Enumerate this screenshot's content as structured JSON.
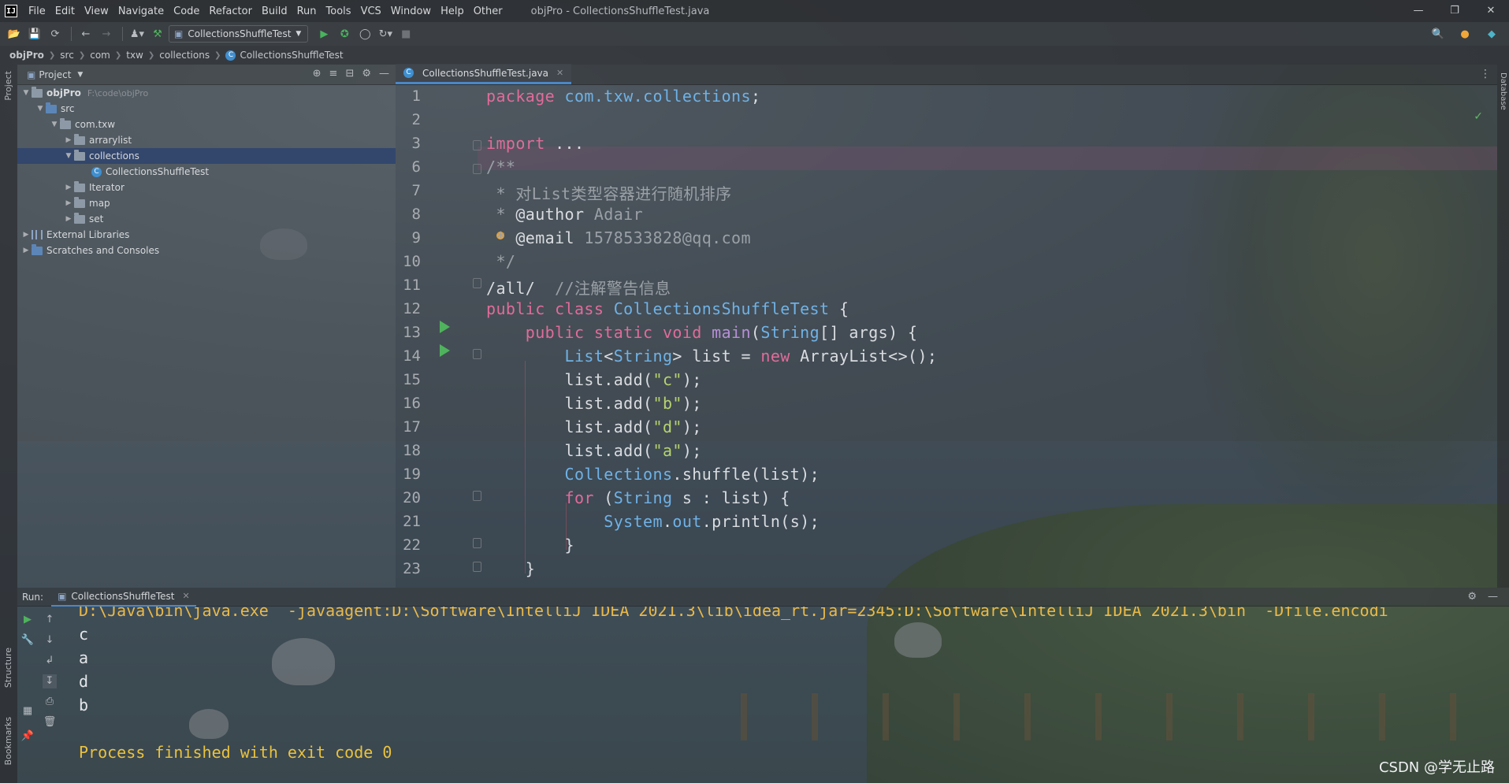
{
  "window": {
    "title": "objPro - CollectionsShuffleTest.java",
    "logo": "IJ",
    "controls": [
      "—",
      "❐",
      "✕"
    ]
  },
  "menu": [
    "File",
    "Edit",
    "View",
    "Navigate",
    "Code",
    "Refactor",
    "Build",
    "Run",
    "Tools",
    "VCS",
    "Window",
    "Help",
    "Other"
  ],
  "toolbar": {
    "run_config": "CollectionsShuffleTest"
  },
  "breadcrumb": [
    "objPro",
    "src",
    "com",
    "txw",
    "collections",
    "CollectionsShuffleTest"
  ],
  "left_strip": {
    "project": "Project",
    "structure": "Structure",
    "bookmarks": "Bookmarks"
  },
  "right_strip": {
    "database": "Database"
  },
  "project_panel": {
    "title": "Project",
    "root": {
      "name": "objPro",
      "path": "F:\\code\\objPro"
    },
    "src": "src",
    "package": "com.txw",
    "folders": [
      "arrarylist",
      "collections",
      "Iterator",
      "map",
      "set"
    ],
    "class_file": "CollectionsShuffleTest",
    "external_libraries": "External Libraries",
    "scratches": "Scratches and Consoles"
  },
  "editor": {
    "tab": "CollectionsShuffleTest.java",
    "line_numbers": [
      "1",
      "2",
      "3",
      "6",
      "7",
      "8",
      "9",
      "10",
      "11",
      "12",
      "13",
      "14",
      "15",
      "16",
      "17",
      "18",
      "19",
      "20",
      "21",
      "22",
      "23"
    ],
    "code": {
      "l1_kw": "package",
      "l1_pkg": "com.txw.collections",
      "l1_end": ";",
      "l3_kw": "import",
      "l3_rest": " ...",
      "l6": "/**",
      "l7": " * 对List类型容器进行随机排序",
      "l8_a": " * ",
      "l8_tag": "@author",
      "l8_val": " Adair",
      "l9_a": " * ",
      "l9_tag": "@email",
      "l9_val": " 1578533828@qq.com",
      "l10": " */",
      "l11_a": "/all/",
      "l11_cm": "  //注解警告信息",
      "l12_kw": "public class ",
      "l12_cls": "CollectionsShuffleTest",
      "l12_end": " {",
      "l13_kw": "    public static void ",
      "l13_fn": "main",
      "l13_p1": "(",
      "l13_ty": "String",
      "l13_p2": "[] args) {",
      "l14_ty1": "        List",
      "l14_p1": "<",
      "l14_ty2": "String",
      "l14_p2": "> list = ",
      "l14_kw": "new",
      "l14_p3": " ArrayList<>();",
      "l15_a": "        list.add(",
      "l15_s": "\"c\"",
      "l15_b": ");",
      "l16_a": "        list.add(",
      "l16_s": "\"b\"",
      "l16_b": ");",
      "l17_a": "        list.add(",
      "l17_s": "\"d\"",
      "l17_b": ");",
      "l18_a": "        list.add(",
      "l18_s": "\"a\"",
      "l18_b": ");",
      "l19_ty": "        Collections",
      "l19_rest": ".shuffle(list);",
      "l20_kw": "        for",
      "l20_p1": " (",
      "l20_ty": "String",
      "l20_p2": " s : list) {",
      "l21_ty": "            System",
      "l21_p1": ".",
      "l21_out": "out",
      "l21_p2": ".println(s);",
      "l22": "        }",
      "l23": "    }"
    }
  },
  "run_panel": {
    "label": "Run:",
    "tab": "CollectionsShuffleTest",
    "command": "D:\\Java\\bin\\java.exe  -javaagent:D:\\Software\\IntelliJ IDEA 2021.3\\lib\\idea_rt.jar=2345:D:\\Software\\IntelliJ IDEA 2021.3\\bin  -Dfile.encodi",
    "output": [
      "c",
      "a",
      "d",
      "b"
    ],
    "exit_message": "Process finished with exit code 0"
  },
  "watermark": "CSDN @学无止路",
  "colors": {
    "keyword": "#e06c9a",
    "type": "#6fb2e6",
    "string": "#b6d36f",
    "comment": "#9aa0a6",
    "run_green": "#4fb35d",
    "selection": "#2e436e",
    "console_yellow": "#e9c23f"
  }
}
